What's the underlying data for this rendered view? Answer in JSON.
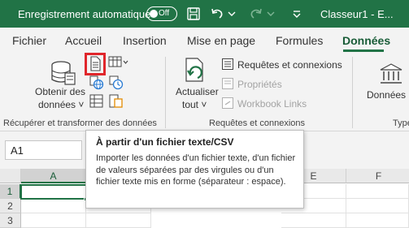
{
  "titlebar": {
    "autosave_label": "Enregistrement automatique",
    "toggle_state": "Off",
    "document_title": "Classeur1  -  E..."
  },
  "tabs": [
    {
      "label": "Fichier",
      "active": false
    },
    {
      "label": "Accueil",
      "active": false
    },
    {
      "label": "Insertion",
      "active": false
    },
    {
      "label": "Mise en page",
      "active": false
    },
    {
      "label": "Formules",
      "active": false
    },
    {
      "label": "Données",
      "active": true
    }
  ],
  "ribbon": {
    "group1": {
      "obtenir_line1": "Obtenir des",
      "obtenir_line2": "données ˅",
      "label": "Récupérer et transformer des données"
    },
    "group2": {
      "actualiser_line1": "Actualiser",
      "actualiser_line2": "tout ˅",
      "requetes": "Requêtes et connexions",
      "proprietes": "Propriétés",
      "workbook_links": "Workbook Links",
      "label": "Requêtes et connexions"
    },
    "group3": {
      "donnees_btn": "Données b",
      "label": "Type"
    }
  },
  "formula_bar": {
    "name_box": "A1"
  },
  "grid": {
    "columns": [
      "A",
      "B",
      "C",
      "D",
      "E",
      "F"
    ],
    "rows": [
      "1",
      "2",
      "3"
    ],
    "selected_column": "A",
    "selected_row": "1"
  },
  "tooltip": {
    "title": "À partir d'un fichier texte/CSV",
    "body": "Importer les données d'un fichier texte, d'un fichier de valeurs séparées par des virgules ou d'un fichier texte mis en forme (séparateur : espace)."
  },
  "colors": {
    "accent": "#217346",
    "highlight_box": "#e0262b"
  }
}
